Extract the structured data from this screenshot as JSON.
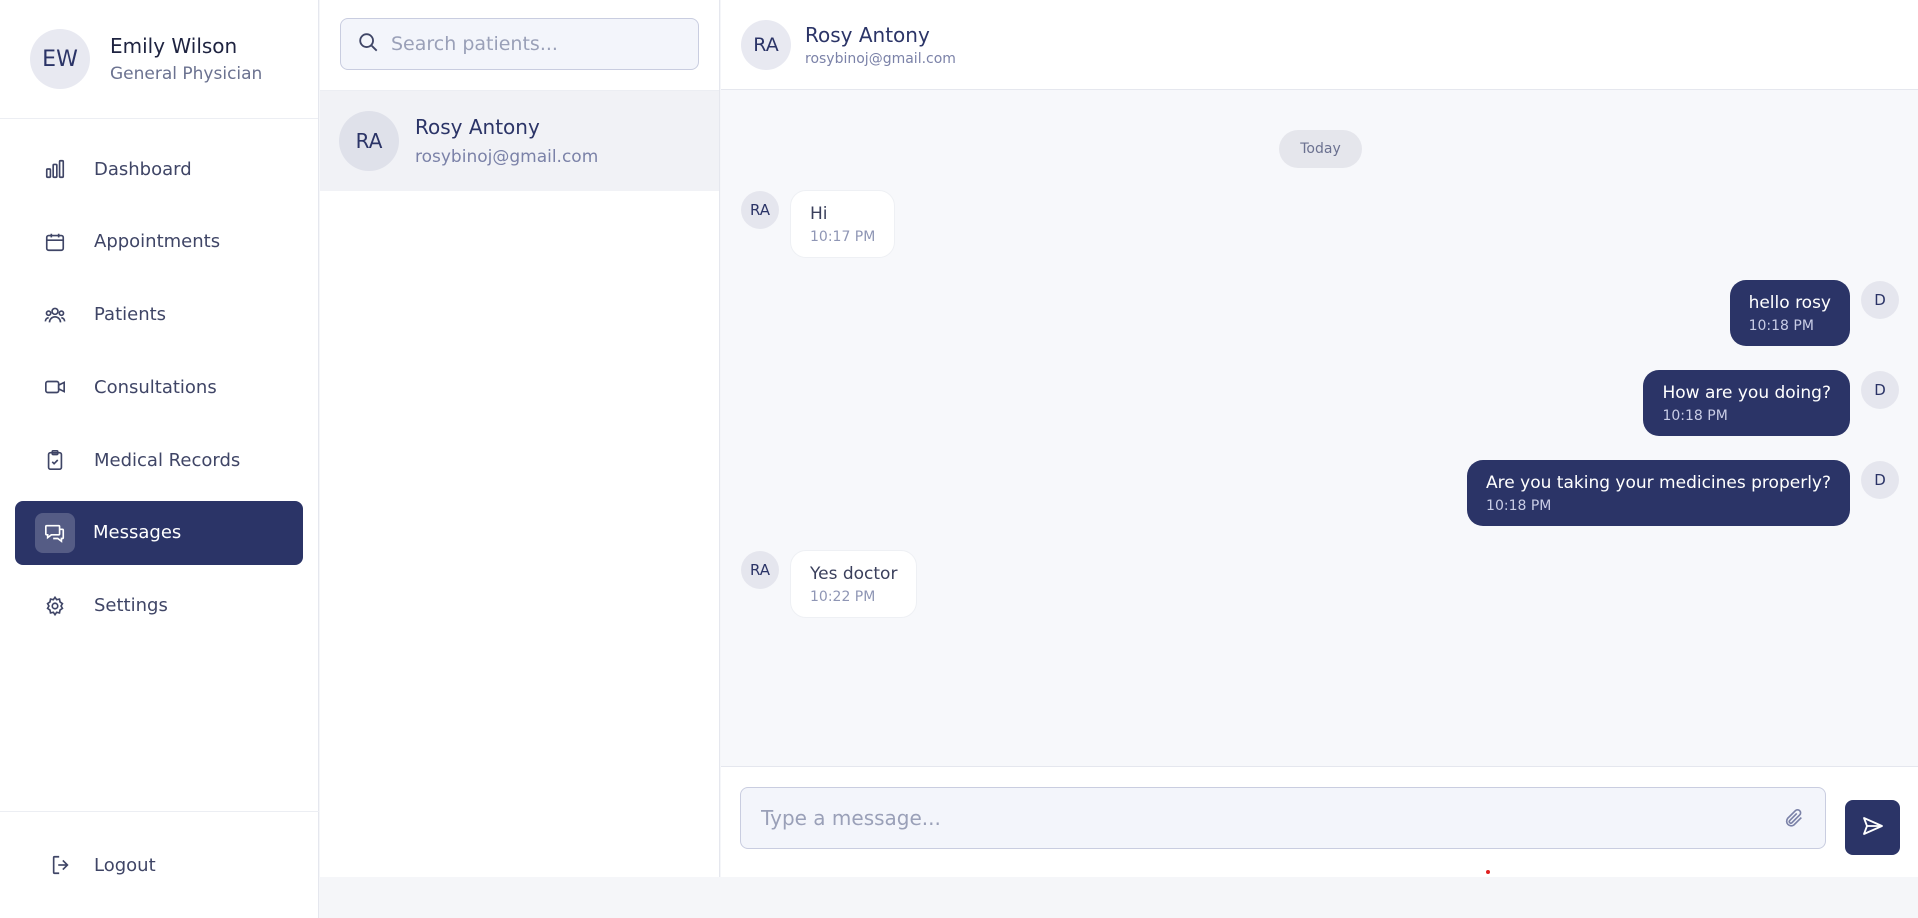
{
  "user": {
    "initials": "EW",
    "name": "Emily Wilson",
    "role": "General Physician"
  },
  "nav": {
    "items": [
      {
        "label": "Dashboard",
        "icon": "bar-chart-icon"
      },
      {
        "label": "Appointments",
        "icon": "calendar-icon"
      },
      {
        "label": "Patients",
        "icon": "users-icon"
      },
      {
        "label": "Consultations",
        "icon": "video-icon"
      },
      {
        "label": "Medical Records",
        "icon": "clipboard-check-icon"
      },
      {
        "label": "Messages",
        "icon": "messages-icon",
        "active": true
      },
      {
        "label": "Settings",
        "icon": "gear-icon"
      }
    ],
    "logout_label": "Logout"
  },
  "search": {
    "placeholder": "Search patients..."
  },
  "patients": [
    {
      "initials": "RA",
      "name": "Rosy Antony",
      "email": "rosybinoj@gmail.com",
      "selected": true
    }
  ],
  "chat": {
    "header": {
      "initials": "RA",
      "name": "Rosy Antony",
      "email": "rosybinoj@gmail.com"
    },
    "date_divider": "Today",
    "messages": [
      {
        "from": "patient",
        "avatar": "RA",
        "text": "Hi",
        "time": "10:17 PM"
      },
      {
        "from": "doctor",
        "avatar": "D",
        "text": "hello rosy",
        "time": "10:18 PM"
      },
      {
        "from": "doctor",
        "avatar": "D",
        "text": "How are you doing?",
        "time": "10:18 PM"
      },
      {
        "from": "doctor",
        "avatar": "D",
        "text": "Are you taking your medicines properly?",
        "time": "10:18 PM"
      },
      {
        "from": "patient",
        "avatar": "RA",
        "text": "Yes doctor",
        "time": "10:22 PM"
      }
    ],
    "composer": {
      "placeholder": "Type a message..."
    }
  },
  "colors": {
    "primary": "#2b3467",
    "background": "#f7f8fb",
    "accent_dot": "#e02020"
  }
}
